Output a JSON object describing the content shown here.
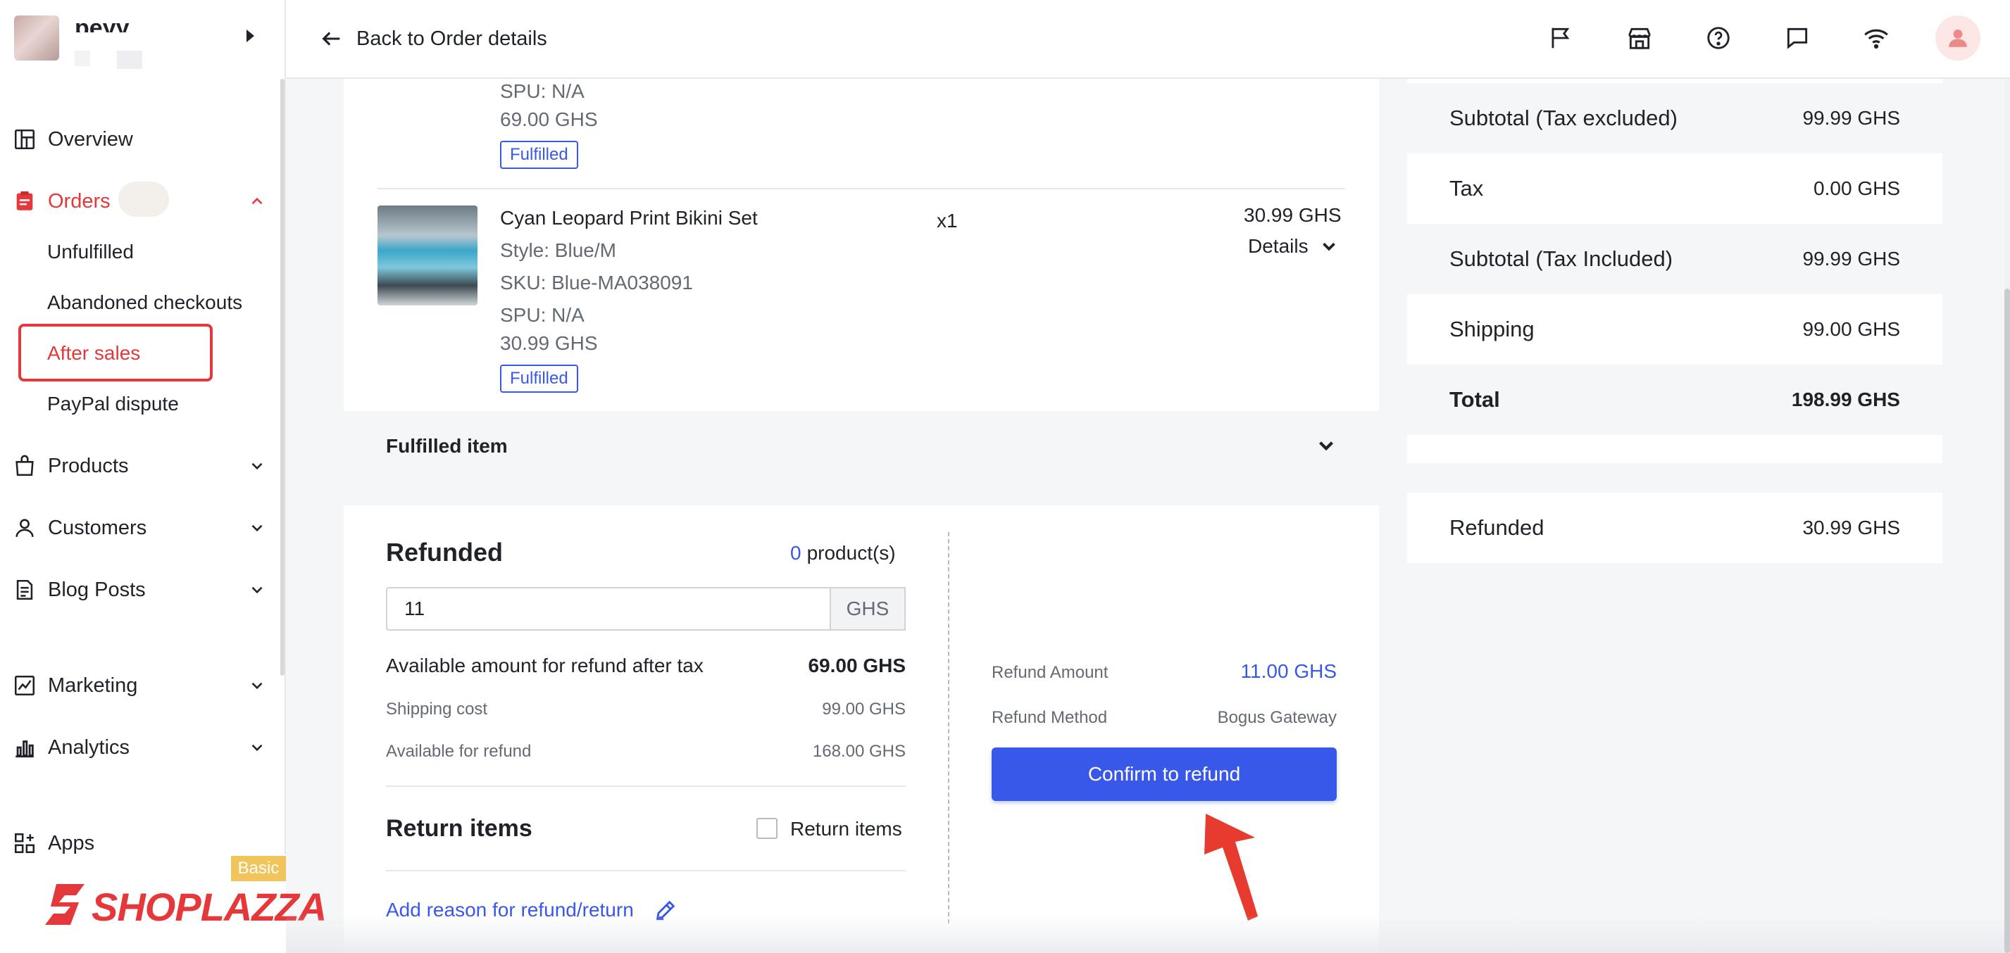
{
  "store": {
    "name": "peyy"
  },
  "sidebar": {
    "items": [
      {
        "label": "Overview",
        "icon": "dashboard-icon"
      },
      {
        "label": "Orders",
        "icon": "orders-icon"
      },
      {
        "label": "Products",
        "icon": "bag-icon"
      },
      {
        "label": "Customers",
        "icon": "user-icon"
      },
      {
        "label": "Blog Posts",
        "icon": "document-icon"
      },
      {
        "label": "Marketing",
        "icon": "marketing-icon"
      },
      {
        "label": "Analytics",
        "icon": "chart-icon"
      },
      {
        "label": "Apps",
        "icon": "apps-icon"
      }
    ],
    "order_subitems": [
      "Unfulfilled",
      "Abandoned checkouts",
      "After sales",
      "PayPal dispute"
    ],
    "plan_badge": "Basic",
    "logo": "SHOPLAZZA",
    "accent_color": "#e5383b"
  },
  "topbar": {
    "back_label": "Back to Order details",
    "icons": [
      "flag-icon",
      "store-icon",
      "help-icon",
      "message-icon",
      "wifi-icon",
      "avatar-icon"
    ]
  },
  "products": [
    {
      "spu": "SPU: N/A",
      "price": "69.00 GHS",
      "status": "Fulfilled"
    },
    {
      "name": "Cyan Leopard Print Bikini Set",
      "style": "Style: Blue/M",
      "sku": "SKU: Blue-MA038091",
      "spu": "SPU: N/A",
      "price": "30.99 GHS",
      "status": "Fulfilled",
      "qty": "x1",
      "total": "30.99 GHS",
      "details_label": "Details"
    }
  ],
  "fulfilled_section": {
    "label": "Fulfilled item"
  },
  "refund": {
    "title": "Refunded",
    "count": "0",
    "count_suffix": "product(s)",
    "amount_value": "11",
    "currency": "GHS",
    "available_after_tax_label": "Available amount for refund after tax",
    "available_after_tax_value": "69.00 GHS",
    "shipping_label": "Shipping cost",
    "shipping_value": "99.00 GHS",
    "available_label": "Available for refund",
    "available_value": "168.00 GHS",
    "return_title": "Return items",
    "return_checkbox_label": "Return items",
    "add_reason_label": "Add reason for refund/return",
    "refund_amount_label": "Refund Amount",
    "refund_amount_value": "11.00 GHS",
    "refund_method_label": "Refund Method",
    "refund_method_value": "Bogus Gateway",
    "confirm_label": "Confirm to refund",
    "primary_color": "#3858e9"
  },
  "summary": {
    "rows": [
      {
        "label": "Subtotal (Tax excluded)",
        "value": "99.99 GHS"
      },
      {
        "label": "Tax",
        "value": "0.00 GHS"
      },
      {
        "label": "Subtotal (Tax Included)",
        "value": "99.99 GHS"
      },
      {
        "label": "Shipping",
        "value": "99.00 GHS"
      },
      {
        "label": "Total",
        "value": "198.99 GHS"
      }
    ],
    "refunded_label": "Refunded",
    "refunded_value": "30.99 GHS"
  }
}
